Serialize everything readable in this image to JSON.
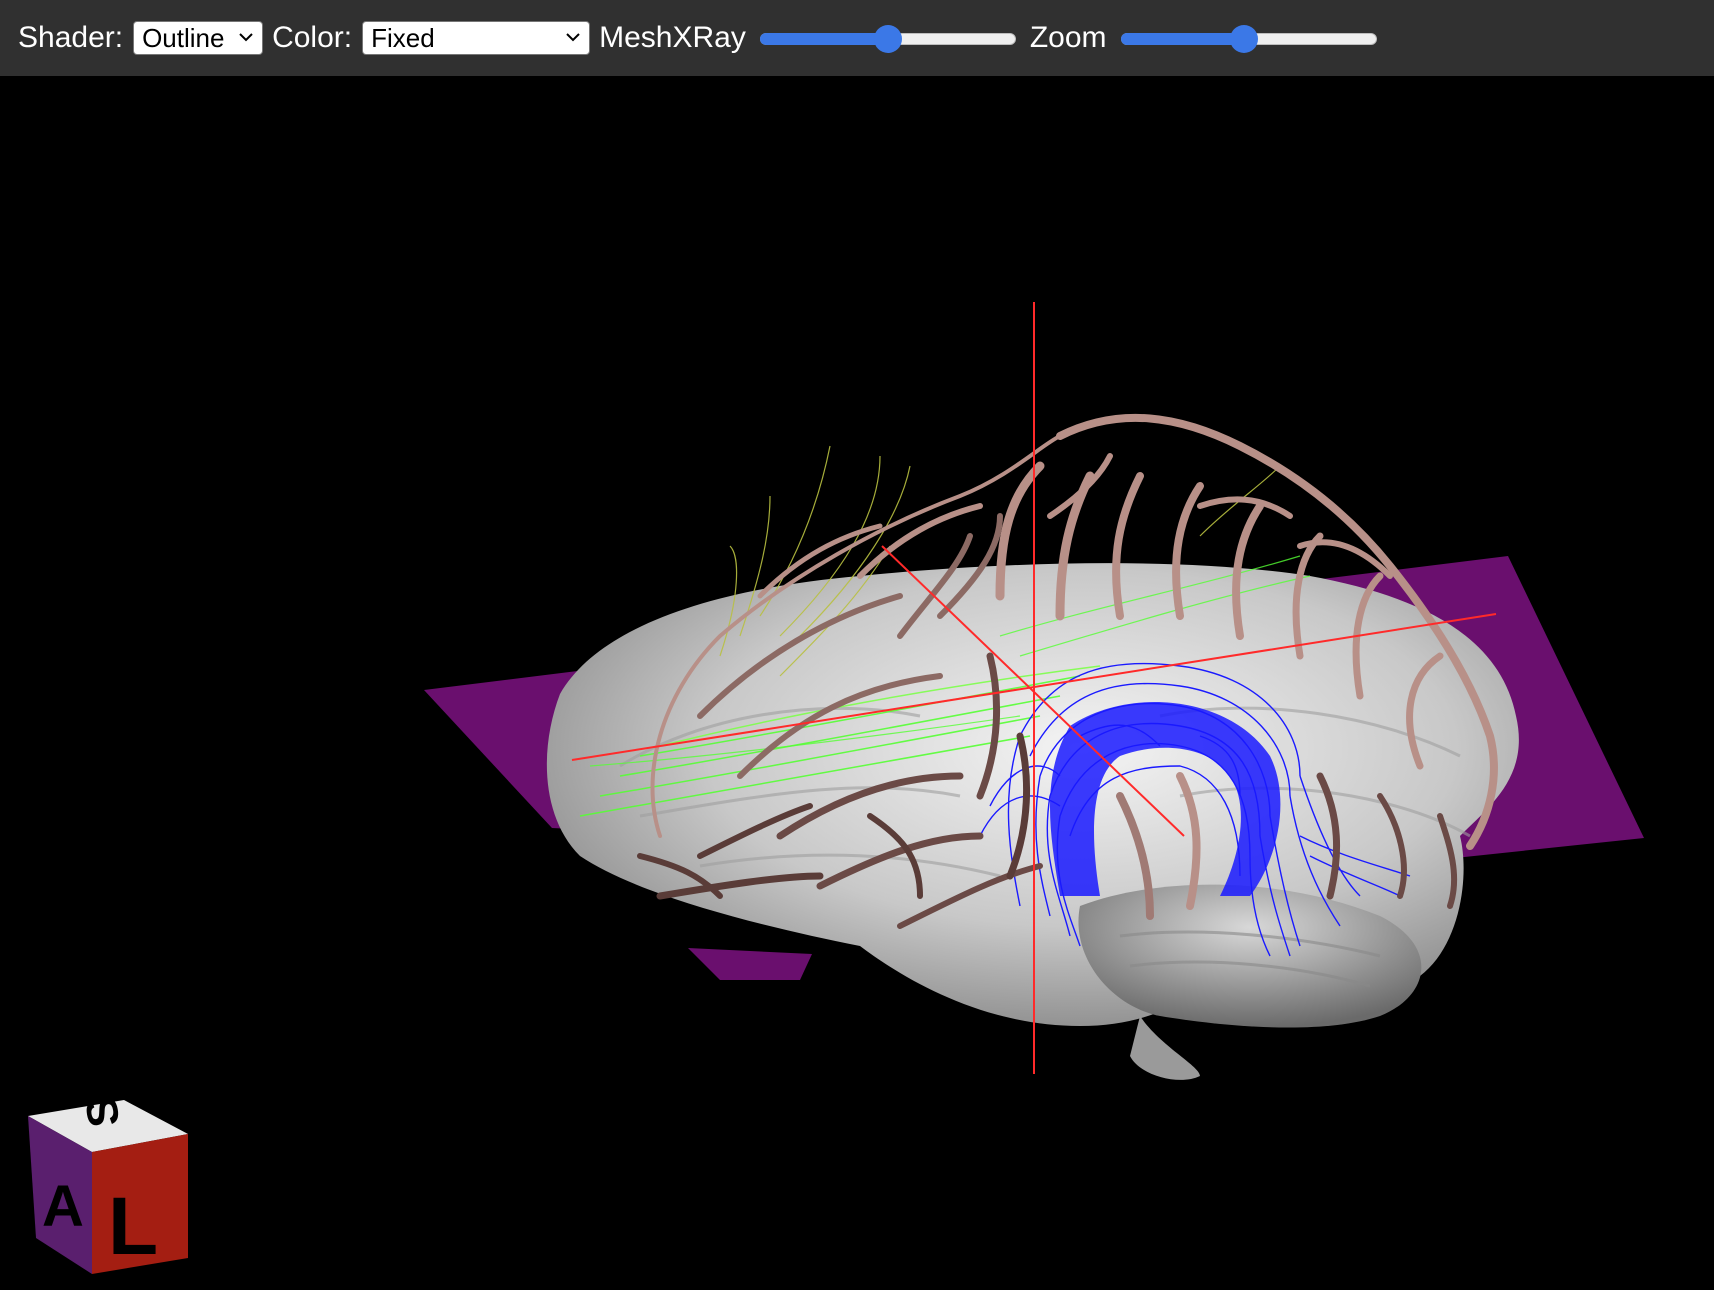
{
  "toolbar": {
    "shader_label": "Shader:",
    "shader_value": "Outline",
    "color_label": "Color:",
    "color_value": "Fixed",
    "meshxray_label": "MeshXRay",
    "meshxray_value": 0.5,
    "zoom_label": "Zoom",
    "zoom_value": 0.48
  },
  "orientation_cube": {
    "top": "S",
    "front": "L",
    "side": "A",
    "top_color": "#e8e8e8",
    "front_color": "#a41e12",
    "side_color": "#5a1f6e"
  },
  "scene": {
    "background": "#000000",
    "plane_color": "#6a0f6e",
    "crosshair_color": "#ff2a2a",
    "mesh_color": "#b89088",
    "fiber_colors": [
      "#1a1aff",
      "#55ff33",
      "#b8c040"
    ]
  }
}
